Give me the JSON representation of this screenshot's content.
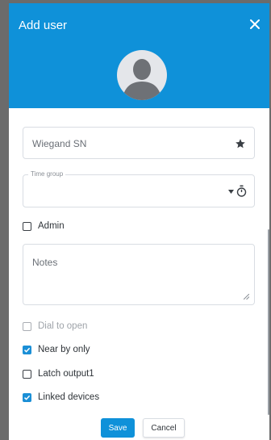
{
  "colors": {
    "accent": "#0f91d9",
    "checkbox_checked": "#1b8fd6"
  },
  "dialog": {
    "title": "Add user",
    "close_icon": "close-icon"
  },
  "avatar": {
    "icon": "user-silhouette-icon"
  },
  "fields": {
    "wiegand": {
      "placeholder": "Wiegand SN",
      "icon": "star-icon"
    },
    "time_group": {
      "label": "Time group",
      "value": "",
      "icons": [
        "dropdown-arrow-icon",
        "stopwatch-icon"
      ]
    },
    "notes": {
      "placeholder": "Notes"
    }
  },
  "checkboxes": {
    "admin": {
      "label": "Admin",
      "checked": false,
      "disabled": false
    },
    "dial": {
      "label": "Dial to open",
      "checked": false,
      "disabled": true
    },
    "near": {
      "label": "Near by only",
      "checked": true,
      "disabled": false
    },
    "latch": {
      "label": "Latch output1",
      "checked": false,
      "disabled": false
    },
    "linked": {
      "label": "Linked devices",
      "checked": true,
      "disabled": false
    }
  },
  "buttons": {
    "save": "Save",
    "cancel": "Cancel"
  }
}
